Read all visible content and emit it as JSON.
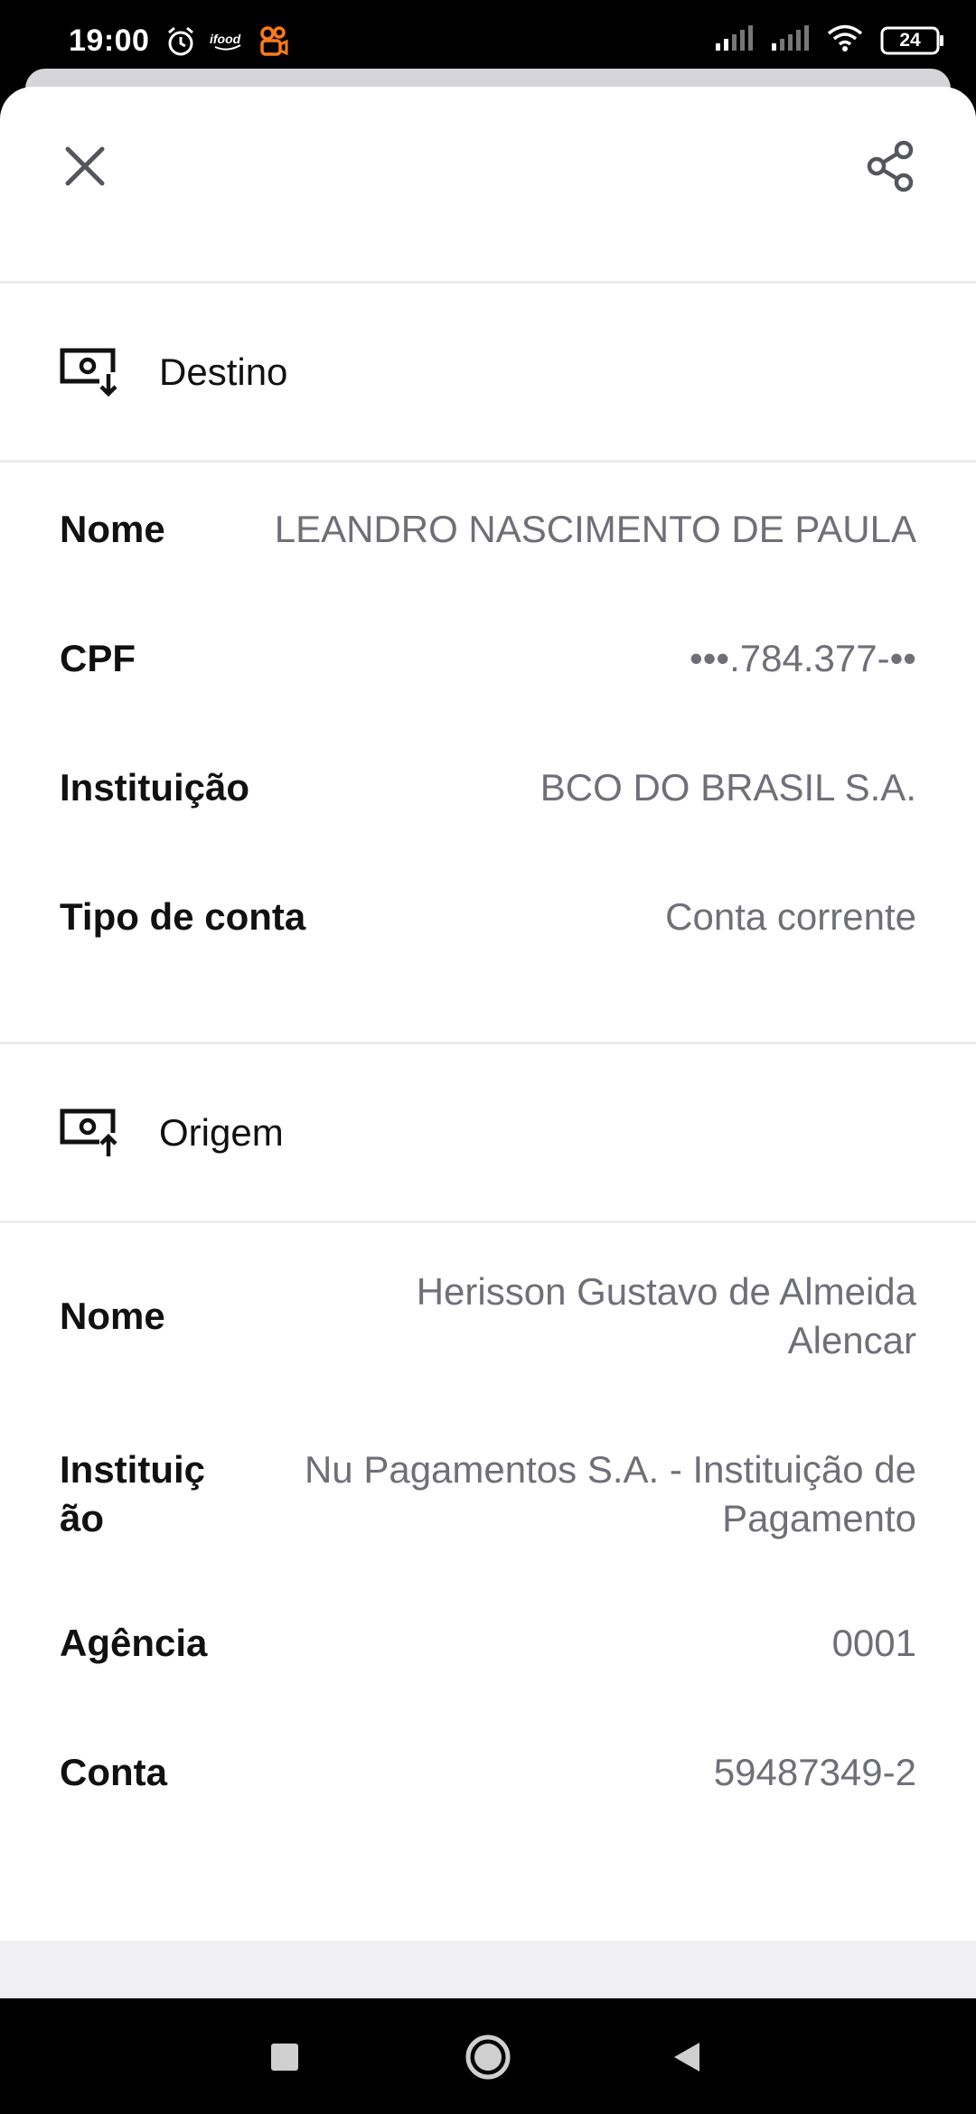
{
  "status_bar": {
    "time": "19:00",
    "battery": "24",
    "icons": [
      "alarm-icon",
      "ifood-icon",
      "kwai-icon",
      "signal-icon",
      "signal-icon",
      "wifi-icon",
      "battery-icon"
    ]
  },
  "header": {
    "close_icon": "close-icon",
    "share_icon": "share-icon"
  },
  "destino": {
    "title": "Destino",
    "icon": "money-in-icon",
    "rows": [
      {
        "label": "Nome",
        "value": "LEANDRO NASCIMENTO DE PAULA"
      },
      {
        "label": "CPF",
        "value": "•••.784.377-••"
      },
      {
        "label": "Instituição",
        "value": "BCO DO BRASIL S.A."
      },
      {
        "label": "Tipo de conta",
        "value": "Conta corrente"
      }
    ]
  },
  "origem": {
    "title": "Origem",
    "icon": "money-out-icon",
    "rows": [
      {
        "label": "Nome",
        "value": "Herisson Gustavo de Almeida Alencar"
      },
      {
        "label": "Instituição",
        "value": "Nu Pagamentos S.A. - Instituição de Pagamento"
      },
      {
        "label": "Agência",
        "value": "0001"
      },
      {
        "label": "Conta",
        "value": "59487349-2"
      }
    ]
  },
  "nav_bar": {
    "icons": [
      "recents-icon",
      "home-icon",
      "back-icon"
    ]
  }
}
